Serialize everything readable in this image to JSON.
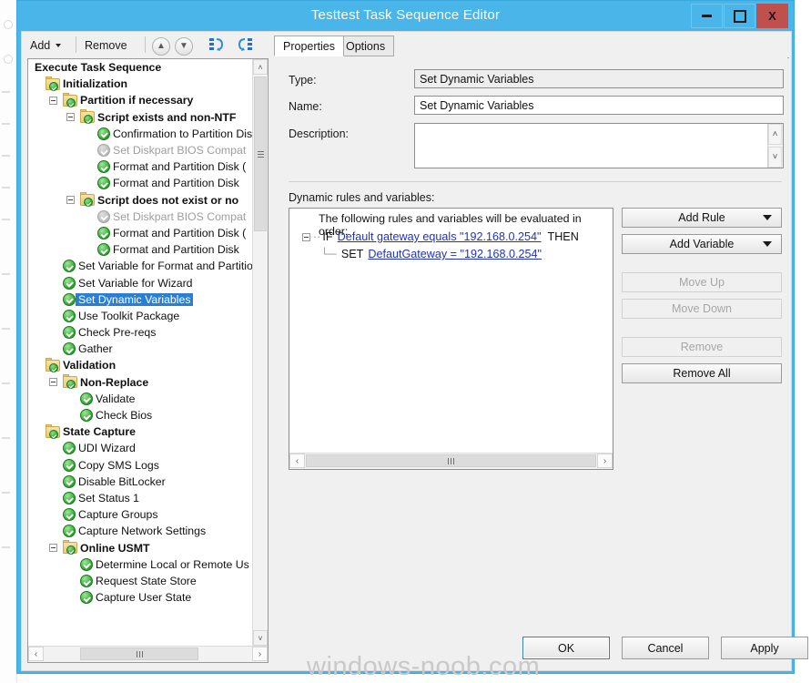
{
  "window": {
    "title": "Testtest Task Sequence Editor",
    "minimize_label": "Minimize",
    "maximize_label": "Maximize",
    "close_label": "X",
    "titlebar_color": "#4ab5e8",
    "close_color": "#c0504d"
  },
  "toolbar": {
    "add_label": "Add",
    "remove_label": "Remove",
    "move_up_icon": "chevron-up-circle-icon",
    "move_down_icon": "chevron-down-circle-icon",
    "copy_icon": "copy-steps-icon",
    "paste_icon": "paste-steps-icon"
  },
  "tabs": [
    {
      "label": "Properties",
      "active": true
    },
    {
      "label": "Options",
      "active": false
    }
  ],
  "tree": {
    "root_label": "Execute Task Sequence",
    "items": [
      {
        "label": "Execute Task Sequence",
        "indent": 0,
        "icon": "none",
        "bold": true,
        "dim": false,
        "selected": false,
        "expander": "none"
      },
      {
        "label": "Initialization",
        "indent": 0,
        "icon": "folder",
        "bold": true,
        "dim": false,
        "selected": false,
        "expander": "none"
      },
      {
        "label": "Partition if necessary",
        "indent": 1,
        "icon": "folder",
        "bold": true,
        "dim": false,
        "selected": false,
        "expander": "minus"
      },
      {
        "label": "Script exists and non-NTF",
        "indent": 2,
        "icon": "folder",
        "bold": true,
        "dim": false,
        "selected": false,
        "expander": "minus"
      },
      {
        "label": "Confirmation to Partition Dis",
        "indent": 3,
        "icon": "check",
        "bold": false,
        "dim": false,
        "selected": false,
        "expander": "none"
      },
      {
        "label": "Set Diskpart BIOS Compat",
        "indent": 3,
        "icon": "check-grey",
        "bold": false,
        "dim": true,
        "selected": false,
        "expander": "none"
      },
      {
        "label": "Format and Partition Disk (",
        "indent": 3,
        "icon": "check",
        "bold": false,
        "dim": false,
        "selected": false,
        "expander": "none"
      },
      {
        "label": "Format and Partition Disk",
        "indent": 3,
        "icon": "check",
        "bold": false,
        "dim": false,
        "selected": false,
        "expander": "none"
      },
      {
        "label": "Script does not exist or no",
        "indent": 2,
        "icon": "folder",
        "bold": true,
        "dim": false,
        "selected": false,
        "expander": "minus"
      },
      {
        "label": "Set Diskpart BIOS Compat",
        "indent": 3,
        "icon": "check-grey",
        "bold": false,
        "dim": true,
        "selected": false,
        "expander": "none"
      },
      {
        "label": "Format and Partition Disk (",
        "indent": 3,
        "icon": "check",
        "bold": false,
        "dim": false,
        "selected": false,
        "expander": "none"
      },
      {
        "label": "Format and Partition Disk",
        "indent": 3,
        "icon": "check",
        "bold": false,
        "dim": false,
        "selected": false,
        "expander": "none"
      },
      {
        "label": "Set Variable for Format and Partitio",
        "indent": 1,
        "icon": "check",
        "bold": false,
        "dim": false,
        "selected": false,
        "expander": "none"
      },
      {
        "label": "Set Variable for Wizard",
        "indent": 1,
        "icon": "check",
        "bold": false,
        "dim": false,
        "selected": false,
        "expander": "none"
      },
      {
        "label": "Set Dynamic Variables",
        "indent": 1,
        "icon": "check",
        "bold": false,
        "dim": false,
        "selected": true,
        "expander": "none"
      },
      {
        "label": "Use Toolkit Package",
        "indent": 1,
        "icon": "check",
        "bold": false,
        "dim": false,
        "selected": false,
        "expander": "none"
      },
      {
        "label": "Check Pre-reqs",
        "indent": 1,
        "icon": "check",
        "bold": false,
        "dim": false,
        "selected": false,
        "expander": "none"
      },
      {
        "label": "Gather",
        "indent": 1,
        "icon": "check",
        "bold": false,
        "dim": false,
        "selected": false,
        "expander": "none"
      },
      {
        "label": "Validation",
        "indent": 0,
        "icon": "folder",
        "bold": true,
        "dim": false,
        "selected": false,
        "expander": "none"
      },
      {
        "label": "Non-Replace",
        "indent": 1,
        "icon": "folder",
        "bold": true,
        "dim": false,
        "selected": false,
        "expander": "minus"
      },
      {
        "label": "Validate",
        "indent": 2,
        "icon": "check",
        "bold": false,
        "dim": false,
        "selected": false,
        "expander": "none"
      },
      {
        "label": "Check Bios",
        "indent": 2,
        "icon": "check",
        "bold": false,
        "dim": false,
        "selected": false,
        "expander": "none"
      },
      {
        "label": "State Capture",
        "indent": 0,
        "icon": "folder",
        "bold": true,
        "dim": false,
        "selected": false,
        "expander": "none"
      },
      {
        "label": "UDI Wizard",
        "indent": 1,
        "icon": "check",
        "bold": false,
        "dim": false,
        "selected": false,
        "expander": "none"
      },
      {
        "label": "Copy SMS Logs",
        "indent": 1,
        "icon": "check",
        "bold": false,
        "dim": false,
        "selected": false,
        "expander": "none"
      },
      {
        "label": "Disable BitLocker",
        "indent": 1,
        "icon": "check",
        "bold": false,
        "dim": false,
        "selected": false,
        "expander": "none"
      },
      {
        "label": "Set Status 1",
        "indent": 1,
        "icon": "check",
        "bold": false,
        "dim": false,
        "selected": false,
        "expander": "none"
      },
      {
        "label": "Capture Groups",
        "indent": 1,
        "icon": "check",
        "bold": false,
        "dim": false,
        "selected": false,
        "expander": "none"
      },
      {
        "label": "Capture Network Settings",
        "indent": 1,
        "icon": "check",
        "bold": false,
        "dim": false,
        "selected": false,
        "expander": "none"
      },
      {
        "label": "Online USMT",
        "indent": 1,
        "icon": "folder",
        "bold": true,
        "dim": false,
        "selected": false,
        "expander": "minus"
      },
      {
        "label": "Determine Local or Remote Us",
        "indent": 2,
        "icon": "check",
        "bold": false,
        "dim": false,
        "selected": false,
        "expander": "none"
      },
      {
        "label": "Request State Store",
        "indent": 2,
        "icon": "check",
        "bold": false,
        "dim": false,
        "selected": false,
        "expander": "none"
      },
      {
        "label": "Capture User State",
        "indent": 2,
        "icon": "check",
        "bold": false,
        "dim": false,
        "selected": false,
        "expander": "none"
      }
    ]
  },
  "properties": {
    "type_label": "Type:",
    "type_value": "Set Dynamic Variables",
    "name_label": "Name:",
    "name_value": "Set Dynamic Variables",
    "description_label": "Description:",
    "description_value": "",
    "description_placeholder": ""
  },
  "rules": {
    "section_label": "Dynamic rules and variables:",
    "hint": "The following rules and variables will be evaluated in order:",
    "if_keyword": "IF",
    "if_condition": "Default gateway equals \"192.168.0.254\"",
    "then_keyword": "THEN",
    "set_keyword": "SET",
    "set_expression": "DefautGateway = \"192.168.0.254\""
  },
  "rule_buttons": [
    {
      "label": "Add Rule",
      "dropdown": true,
      "disabled": false
    },
    {
      "label": "Add Variable",
      "dropdown": true,
      "disabled": false
    },
    {
      "label": "Move Up",
      "dropdown": false,
      "disabled": true
    },
    {
      "label": "Move Down",
      "dropdown": false,
      "disabled": true
    },
    {
      "label": "Remove",
      "dropdown": false,
      "disabled": true
    },
    {
      "label": "Remove All",
      "dropdown": false,
      "disabled": false
    }
  ],
  "dialog_buttons": [
    {
      "label": "OK",
      "default": true
    },
    {
      "label": "Cancel",
      "default": false
    },
    {
      "label": "Apply",
      "default": false
    }
  ],
  "watermark": "windows-noob.com",
  "scrollbars": {
    "tree_up_arrow": "˄",
    "tree_down_arrow": "˅",
    "left_arrow": "‹",
    "right_arrow": "›"
  }
}
